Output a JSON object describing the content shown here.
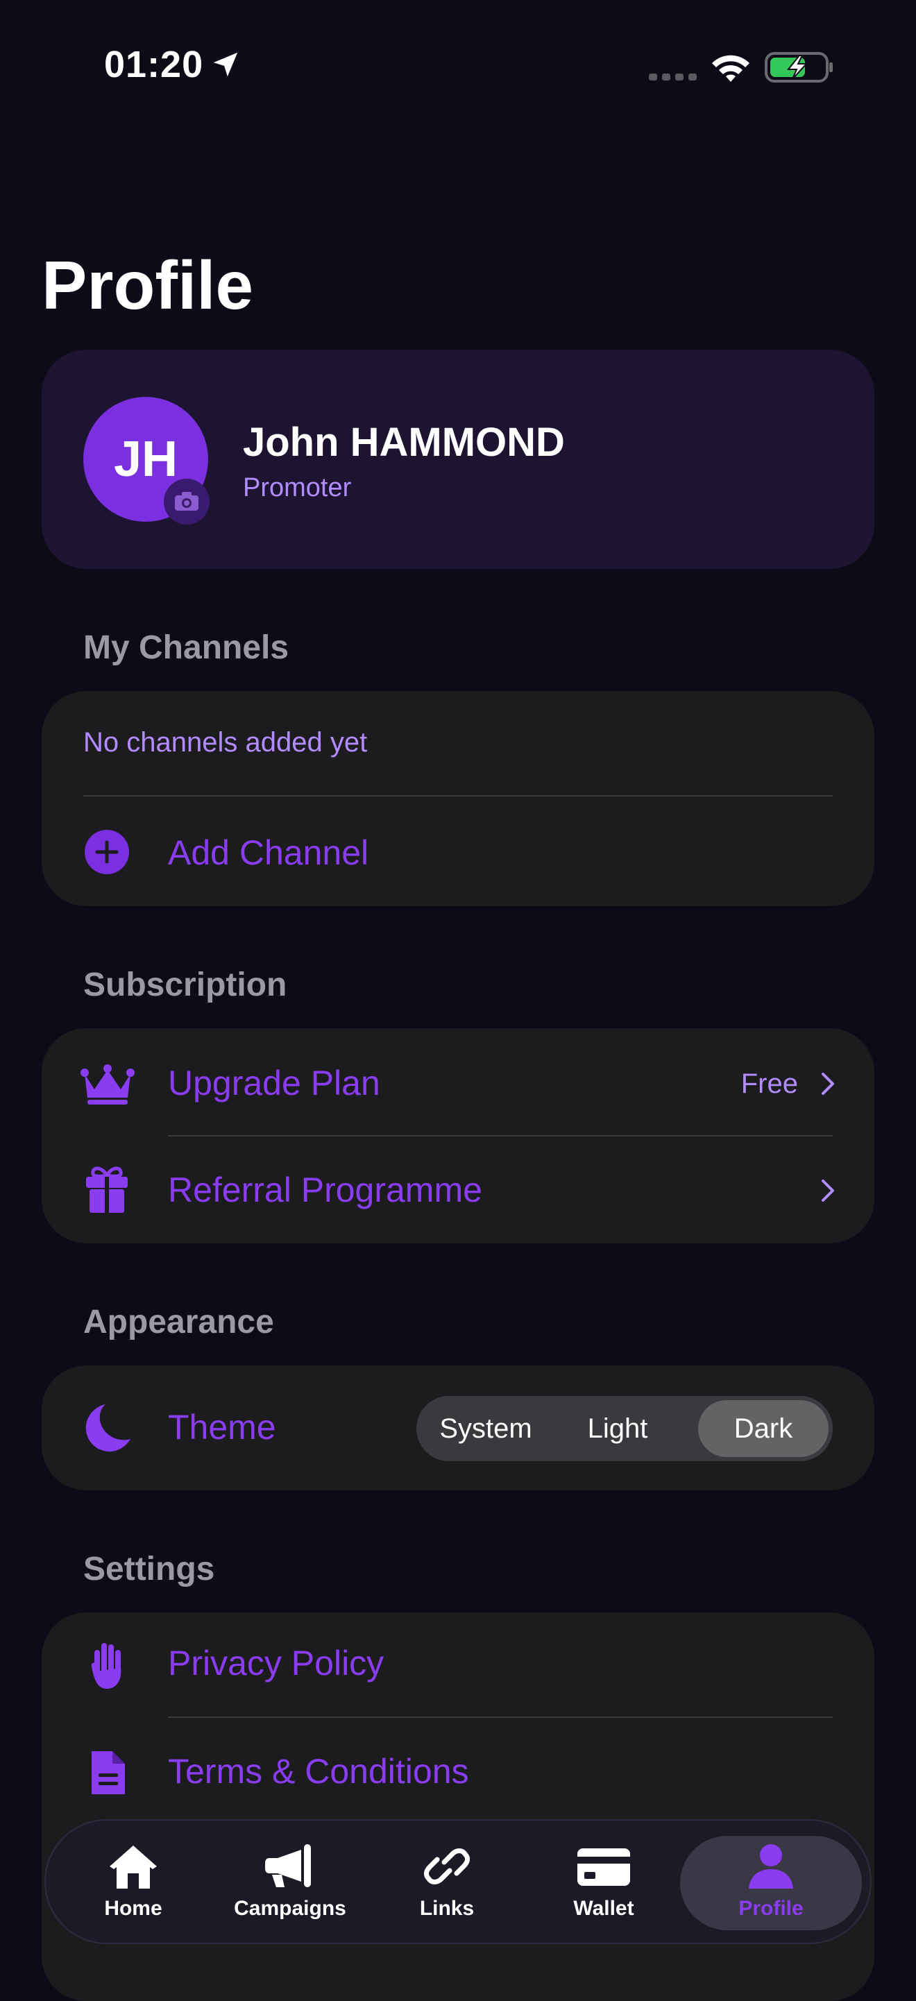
{
  "status_bar": {
    "time": "01:20"
  },
  "page": {
    "title": "Profile"
  },
  "profile": {
    "initials": "JH",
    "name": "John HAMMOND",
    "role": "Promoter"
  },
  "channels": {
    "section_label": "My Channels",
    "empty_text": "No channels added yet",
    "add_label": "Add Channel"
  },
  "subscription": {
    "section_label": "Subscription",
    "upgrade_label": "Upgrade Plan",
    "plan_value": "Free",
    "referral_label": "Referral Programme"
  },
  "appearance": {
    "section_label": "Appearance",
    "theme_label": "Theme",
    "options": [
      "System",
      "Light",
      "Dark"
    ],
    "selected": "Dark"
  },
  "settings": {
    "section_label": "Settings",
    "privacy_label": "Privacy Policy",
    "terms_label": "Terms & Conditions"
  },
  "tabbar": {
    "tabs": [
      {
        "label": "Home",
        "icon": "home-icon"
      },
      {
        "label": "Campaigns",
        "icon": "megaphone-icon"
      },
      {
        "label": "Links",
        "icon": "link-icon"
      },
      {
        "label": "Wallet",
        "icon": "wallet-icon"
      },
      {
        "label": "Profile",
        "icon": "person-icon"
      }
    ],
    "active": "Profile"
  },
  "colors": {
    "accent": "#7a2fe0",
    "accent_text": "#8a3cf0",
    "background": "#0e0b18",
    "card": "#1c1c1e"
  }
}
